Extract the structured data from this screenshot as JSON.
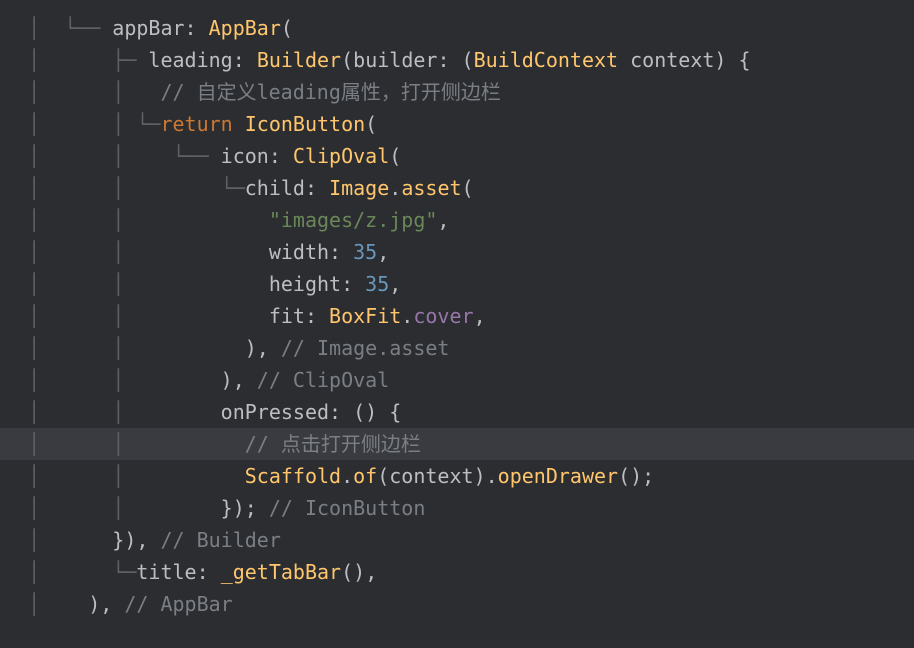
{
  "code": {
    "line1": {
      "guide": "│  └── ",
      "param": "appBar",
      "colon": ": ",
      "type": "AppBar",
      "paren": "("
    },
    "line2": {
      "guide": "│      ├─ ",
      "param": "leading",
      "colon": ": ",
      "type": "Builder",
      "paren": "(",
      "param2": "builder",
      "colon2": ": (",
      "type2": "BuildContext",
      "space": " ",
      "var": "context",
      "end": ") {"
    },
    "line3": {
      "guide": "│      │   ",
      "comment": "// 自定义leading属性，打开侧边栏"
    },
    "line4": {
      "guide": "│      │ └─",
      "keyword": "return",
      "space": " ",
      "type": "IconButton",
      "paren": "("
    },
    "line5": {
      "guide": "│      │    └── ",
      "param": "icon",
      "colon": ": ",
      "type": "ClipOval",
      "paren": "("
    },
    "line6": {
      "guide": "│      │        └─",
      "param": "child",
      "colon": ": ",
      "type": "Image",
      "dot": ".",
      "method": "asset",
      "paren": "("
    },
    "line7": {
      "guide": "│      │            ",
      "string": "\"images/z.jpg\"",
      "comma": ","
    },
    "line8": {
      "guide": "│      │            ",
      "param": "width",
      "colon": ": ",
      "number": "35",
      "comma": ","
    },
    "line9": {
      "guide": "│      │            ",
      "param": "height",
      "colon": ": ",
      "number": "35",
      "comma": ","
    },
    "line10": {
      "guide": "│      │            ",
      "param": "fit",
      "colon": ": ",
      "type": "BoxFit",
      "dot": ".",
      "prop": "cover",
      "comma": ","
    },
    "line11": {
      "guide": "│      │          ",
      "close": "),",
      "comment": " // Image.asset"
    },
    "line12": {
      "guide": "│      │        ",
      "close": "),",
      "comment": " // ClipOval"
    },
    "line13": {
      "guide": "│      │        ",
      "param": "onPressed",
      "colon": ": () {"
    },
    "line14": {
      "guide": "│      │          ",
      "comment": "// 点击打开侧边栏"
    },
    "line15": {
      "guide": "│      │          ",
      "type": "Scaffold",
      "dot": ".",
      "method": "of",
      "paren": "(",
      "var": "context",
      "close": ").",
      "method2": "openDrawer",
      "end": "();"
    },
    "line16": {
      "guide": "│      │        ",
      "close": "});",
      "comment": " // IconButton"
    },
    "line17": {
      "guide": "│      ",
      "close": "}),",
      "comment": " // Builder"
    },
    "line18": {
      "guide": "│      └─",
      "param": "title",
      "colon": ": ",
      "method": "_getTabBar",
      "end": "(),"
    },
    "line19": {
      "guide": "│    ",
      "close": "),",
      "comment": " // AppBar"
    }
  }
}
